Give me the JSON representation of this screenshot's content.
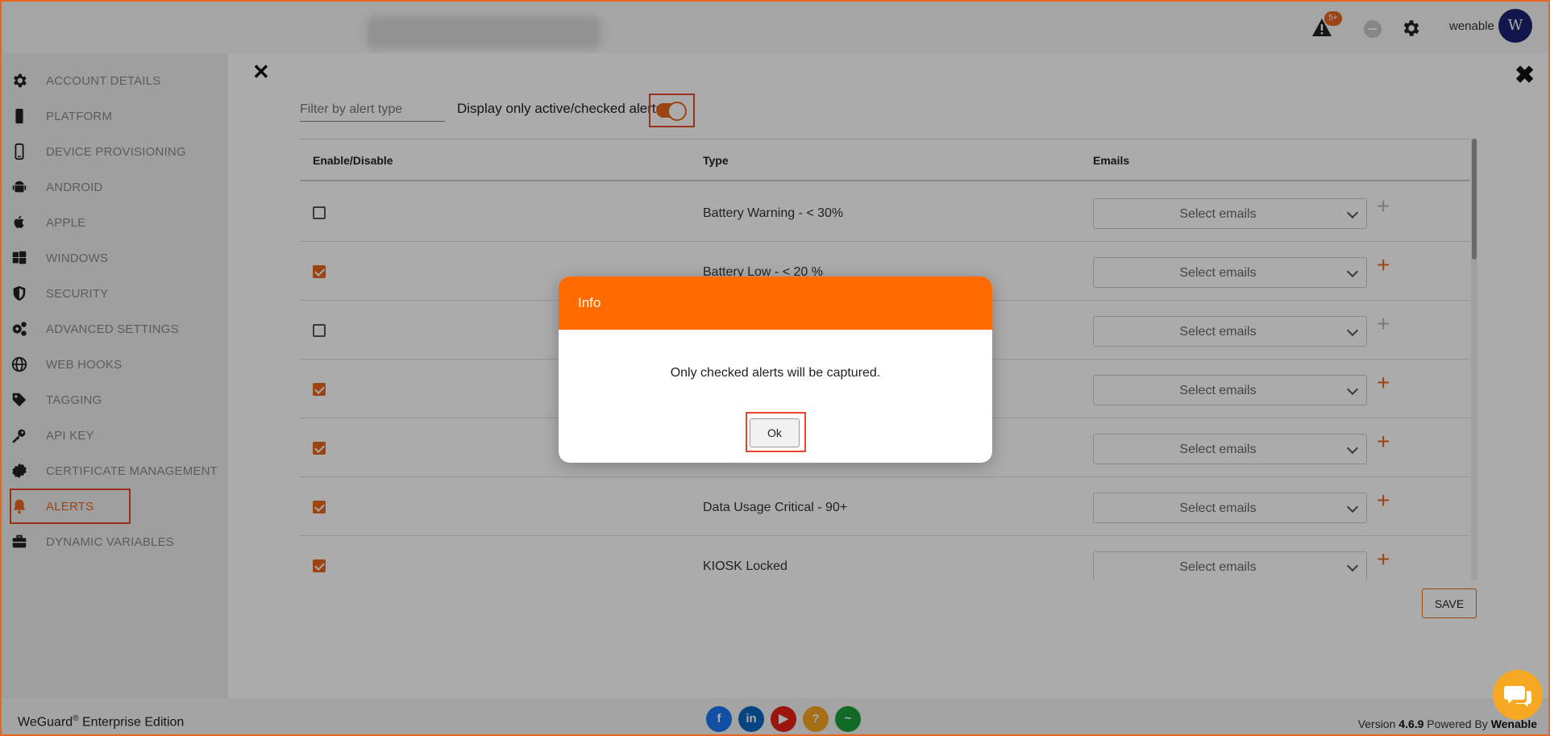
{
  "header": {
    "username": "wenable",
    "avatar_letter": "W",
    "alert_badge": "5+",
    "icons": [
      "warning-icon",
      "minus-circle-icon",
      "gear-icon"
    ]
  },
  "sidebar": {
    "items": [
      {
        "label": "ACCOUNT DETAILS",
        "icon": "gear-icon"
      },
      {
        "label": "PLATFORM",
        "icon": "phone-icon"
      },
      {
        "label": "DEVICE PROVISIONING",
        "icon": "mobile-icon"
      },
      {
        "label": "ANDROID",
        "icon": "android-icon"
      },
      {
        "label": "APPLE",
        "icon": "apple-icon"
      },
      {
        "label": "WINDOWS",
        "icon": "windows-icon"
      },
      {
        "label": "SECURITY",
        "icon": "shield-icon"
      },
      {
        "label": "ADVANCED SETTINGS",
        "icon": "gears-icon"
      },
      {
        "label": "WEB HOOKS",
        "icon": "globe-icon"
      },
      {
        "label": "TAGGING",
        "icon": "tag-icon"
      },
      {
        "label": "API KEY",
        "icon": "key-icon"
      },
      {
        "label": "CERTIFICATE MANAGEMENT",
        "icon": "certificate-icon"
      },
      {
        "label": "ALERTS",
        "icon": "bell-icon"
      },
      {
        "label": "DYNAMIC VARIABLES",
        "icon": "briefcase-icon"
      }
    ],
    "active_index": 12
  },
  "filters": {
    "filter_placeholder": "Filter by alert type",
    "toggle_label": "Display only active/checked alerts",
    "toggle_on": true
  },
  "table": {
    "headers": {
      "enable": "Enable/Disable",
      "type": "Type",
      "emails": "Emails"
    },
    "email_placeholder": "Select emails",
    "rows": [
      {
        "checked": false,
        "type": "Battery Warning - < 30%"
      },
      {
        "checked": true,
        "type": "Battery Low - < 20 %"
      },
      {
        "checked": false,
        "type": ""
      },
      {
        "checked": true,
        "type": ""
      },
      {
        "checked": true,
        "type": ""
      },
      {
        "checked": true,
        "type": "Data Usage Critical - 90+"
      },
      {
        "checked": true,
        "type": "KIOSK Locked"
      }
    ]
  },
  "actions": {
    "save_label": "SAVE"
  },
  "modal": {
    "title": "Info",
    "message": "Only checked alerts will be captured.",
    "ok_label": "Ok"
  },
  "footer": {
    "brand_name": "WeGuard",
    "brand_mark": "®",
    "brand_suffix": " Enterprise Edition",
    "version_prefix": "Version ",
    "version": "4.6.9",
    "powered_prefix": "  Powered By ",
    "powered_by": "Wenable",
    "social": [
      {
        "name": "facebook-icon",
        "glyph": "f",
        "color": "#1877f2"
      },
      {
        "name": "linkedin-icon",
        "glyph": "in",
        "color": "#0a66c2"
      },
      {
        "name": "youtube-icon",
        "glyph": "▶",
        "color": "#e62117"
      },
      {
        "name": "help-icon",
        "glyph": "?",
        "color": "#f5a623"
      },
      {
        "name": "status-icon",
        "glyph": "~",
        "color": "#1a9e3a"
      }
    ]
  },
  "colors": {
    "accent": "#e8661e",
    "modal_header": "#ff6b00",
    "avatar": "#1a2170"
  }
}
